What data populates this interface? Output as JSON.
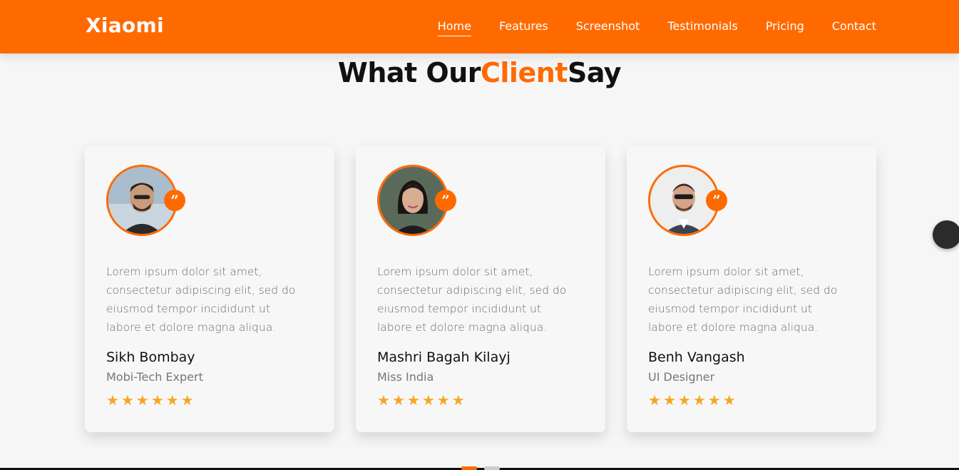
{
  "header": {
    "brand": "Xiaomi",
    "nav": [
      {
        "label": "Home",
        "active": true
      },
      {
        "label": "Features"
      },
      {
        "label": "Screenshot"
      },
      {
        "label": "Testimonials"
      },
      {
        "label": "Pricing"
      },
      {
        "label": "Contact"
      }
    ]
  },
  "section": {
    "title_pre": "What Our",
    "title_accent": "Client",
    "title_post": "Say"
  },
  "testimonials": [
    {
      "text": "Lorem ipsum dolor sit amet, consectetur adipiscing elit, sed do eiusmod tempor incididunt ut labore et dolore magna aliqua.",
      "name": "Sikh Bombay",
      "role": "Mobi-Tech Expert",
      "rating": 6,
      "quote_icon": "quote-icon"
    },
    {
      "text": "Lorem ipsum dolor sit amet, consectetur adipiscing elit, sed do eiusmod tempor incididunt ut labore et dolore magna aliqua.",
      "name": "Mashri Bagah Kilayj",
      "role": "Miss India",
      "rating": 6,
      "quote_icon": "quote-icon"
    },
    {
      "text": "Lorem ipsum dolor sit amet, consectetur adipiscing elit, sed do eiusmod tempor incididunt ut labore et dolore magna aliqua.",
      "name": "Benh Vangash",
      "role": "UI Designer",
      "rating": 6,
      "quote_icon": "quote-icon"
    }
  ],
  "colors": {
    "accent": "#ff6a00",
    "star": "#f5a623",
    "floating_button": "#2b2b2b"
  },
  "carousel": {
    "pages": 2,
    "active": 1
  }
}
